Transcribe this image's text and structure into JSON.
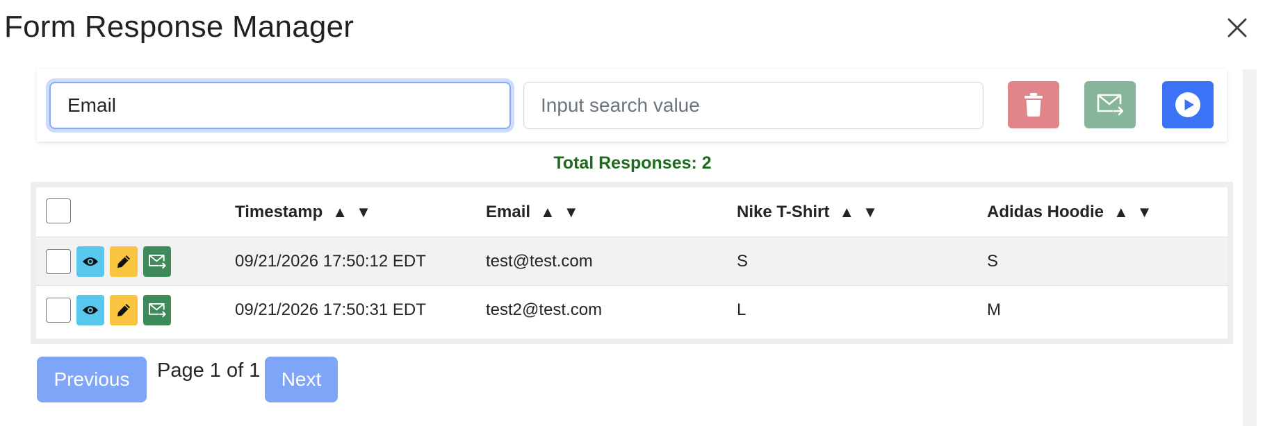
{
  "dialog": {
    "title": "Form Response Manager"
  },
  "toolbar": {
    "field_select_value": "Email",
    "search_placeholder": "Input search value",
    "search_value": ""
  },
  "summary": {
    "total_label": "Total Responses: 2"
  },
  "table": {
    "columns": [
      "Timestamp",
      "Email",
      "Nike T-Shirt",
      "Adidas Hoodie"
    ],
    "sort_up": "▲",
    "sort_down": "▼",
    "rows": [
      [
        "09/21/2026 17:50:12 EDT",
        "test@test.com",
        "S",
        "S"
      ],
      [
        "09/21/2026 17:50:31 EDT",
        "test2@test.com",
        "L",
        "M"
      ]
    ]
  },
  "pager": {
    "prev_label": "Previous",
    "page_info": "Page 1 of 1",
    "next_label": "Next"
  },
  "icons": {
    "close": "close-icon",
    "delete": "trash-icon",
    "send_all": "mail-forward-icon",
    "run": "play-circle-icon",
    "view": "eye-icon",
    "edit": "pencil-icon",
    "mail": "mail-forward-icon"
  },
  "colors": {
    "delete_btn": "#e0868a",
    "send_btn": "#86b59a",
    "run_btn": "#3b73f6",
    "total_text": "#1e6b1e",
    "pager_btn": "#7fa5f8",
    "view_btn": "#57c7ee",
    "edit_btn": "#f9c440",
    "mail_btn": "#3f8a5a"
  }
}
